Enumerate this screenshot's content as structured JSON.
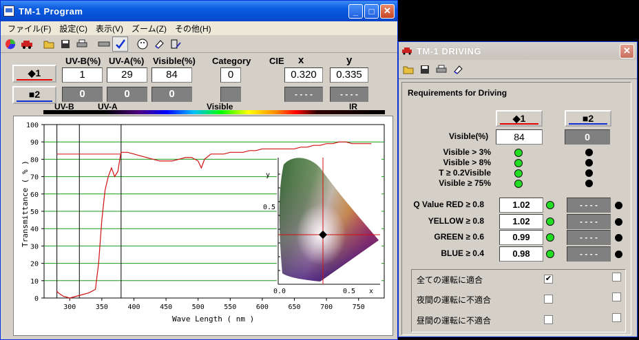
{
  "main_window": {
    "title": "TM-1 Program",
    "menu": [
      "ファイル(F)",
      "設定(C)",
      "表示(V)",
      "ズーム(Z)",
      "その他(H)"
    ],
    "headers": {
      "uvb": "UV-B(%)",
      "uva": "UV-A(%)",
      "visible": "Visible(%)",
      "category": "Category",
      "cie": "CIE",
      "x": "x",
      "y": "y"
    },
    "sample1": {
      "label": "◆1",
      "uvb": "1",
      "uva": "29",
      "visible": "84",
      "category": "0",
      "x": "0.320",
      "y": "0.335"
    },
    "sample2": {
      "label": "■2",
      "uvb": "0",
      "uva": "0",
      "visible": "0",
      "x": "- - - -",
      "y": "- - - -"
    },
    "spectrum_labels": {
      "uvb": "UV-B",
      "uva": "UV-A",
      "visible": "Visible",
      "ir": "IR"
    },
    "plot": {
      "ylabel": "Transmittance ( % )",
      "xlabel": "Wave Length ( nm )",
      "yticks": [
        "100",
        "90",
        "80",
        "70",
        "60",
        "50",
        "40",
        "30",
        "20",
        "10",
        "0"
      ],
      "xticks": [
        "300",
        "350",
        "400",
        "450",
        "500",
        "550",
        "600",
        "650",
        "700",
        "750"
      ],
      "cie_inset": {
        "y_axis": "y",
        "y_tick": "0.5",
        "x_ticks": [
          "0.0",
          "0.5"
        ],
        "x_axis": "x"
      }
    }
  },
  "chart_data": {
    "type": "line",
    "xlabel": "Wave Length ( nm )",
    "ylabel": "Transmittance ( % )",
    "xlim": [
      260,
      790
    ],
    "ylim": [
      0,
      100
    ],
    "series": [
      {
        "x": [
          280,
          282,
          290,
          300,
          310,
          320,
          330,
          340,
          345,
          350,
          355,
          360,
          365,
          370,
          375,
          378,
          380,
          385,
          390,
          400,
          410,
          420,
          430,
          440,
          450,
          460,
          470,
          480,
          490,
          500,
          505,
          510,
          520,
          530,
          540,
          550,
          560,
          570,
          580,
          590,
          600,
          610,
          620,
          630,
          640,
          650,
          660,
          670,
          680,
          690,
          700,
          710,
          720,
          730,
          740,
          750,
          760,
          770
        ],
        "y": [
          4,
          3,
          1,
          0,
          1,
          2,
          3,
          5,
          20,
          45,
          62,
          70,
          75,
          70,
          73,
          80,
          84,
          84,
          84,
          83,
          82,
          81,
          80,
          79,
          79,
          79,
          80,
          81,
          81,
          79,
          75,
          80,
          83,
          83,
          83,
          84,
          84,
          84,
          85,
          85,
          86,
          86,
          86,
          86,
          86,
          86,
          87,
          87,
          88,
          88,
          89,
          89,
          90,
          90,
          89,
          89,
          89,
          89
        ]
      }
    ],
    "reference_lines": {
      "uv_ab_level": 83,
      "x_markers": [
        280,
        315,
        380
      ]
    },
    "grid": true
  },
  "driving_window": {
    "title": "TM-1 DRIVING",
    "heading": "Requirements for Driving",
    "col1": "◆1",
    "col2": "■2",
    "visible_label": "Visible(%)",
    "visible1": "84",
    "visible2": "0",
    "checks": [
      "Visible > 3%",
      "Visible > 8%",
      "T ≥ 0.2Visible",
      "Visible ≥ 75%"
    ],
    "checks_status1": [
      "green",
      "green",
      "green",
      "green"
    ],
    "checks_status2": [
      "black",
      "black",
      "black",
      "black"
    ],
    "q_rows": [
      {
        "label": "Q Value RED ≥ 0.8",
        "v1": "1.02",
        "v2": "- - - -"
      },
      {
        "label": "YELLOW ≥ 0.8",
        "v1": "1.02",
        "v2": "- - - -"
      },
      {
        "label": "GREEN ≥ 0.6",
        "v1": "0.99",
        "v2": "- - - -"
      },
      {
        "label": "BLUE ≥ 0.4",
        "v1": "0.98",
        "v2": "- - - -"
      }
    ],
    "verdicts": [
      {
        "label": "全ての運転に適合",
        "c1": "✔",
        "c2": ""
      },
      {
        "label": "夜間の運転に不適合",
        "c1": "",
        "c2": ""
      },
      {
        "label": "昼間の運転に不適合",
        "c1": "",
        "c2": ""
      }
    ]
  },
  "colors": {
    "curve": "#d01010",
    "grid": "#1a9a1a",
    "title_blue": "#0a5ae0",
    "sample1_line": "#e00000",
    "sample2_line": "#1030d0"
  }
}
